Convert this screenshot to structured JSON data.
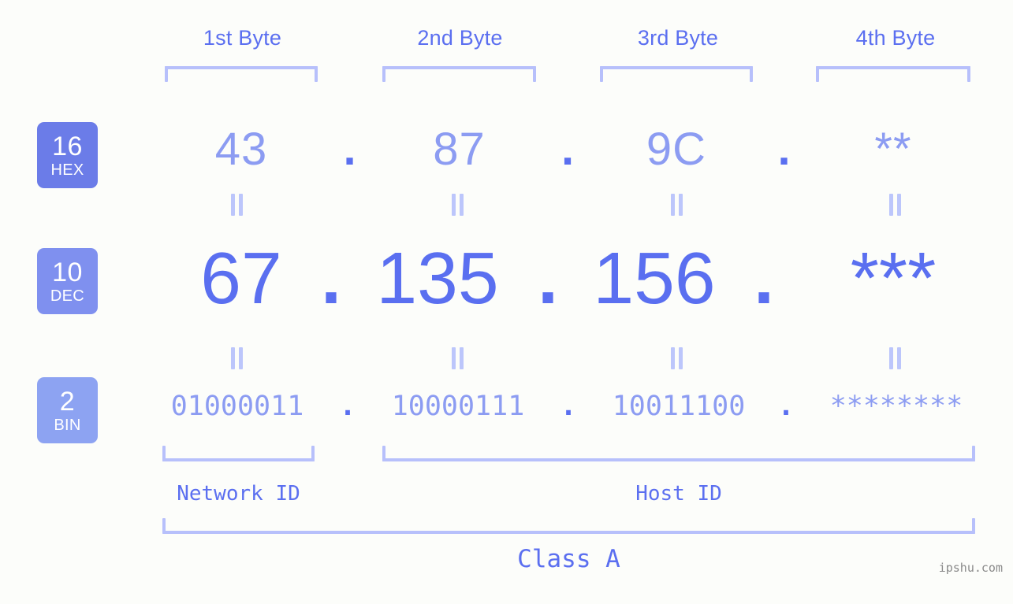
{
  "watermark": "ipshu.com",
  "columns": [
    {
      "header": "1st Byte"
    },
    {
      "header": "2nd Byte"
    },
    {
      "header": "3rd Byte"
    },
    {
      "header": "4th Byte"
    }
  ],
  "rows": {
    "hex": {
      "badge_num": "16",
      "badge_abbr": "HEX",
      "values": [
        "43",
        "87",
        "9C",
        "**"
      ],
      "separator": "."
    },
    "dec": {
      "badge_num": "10",
      "badge_abbr": "DEC",
      "values": [
        "67",
        "135",
        "156",
        "***"
      ],
      "separator": "."
    },
    "bin": {
      "badge_num": "2",
      "badge_abbr": "BIN",
      "values": [
        "01000011",
        "10000111",
        "10011100",
        "********"
      ],
      "separator": "."
    }
  },
  "sections": {
    "network_id": "Network ID",
    "host_id": "Host ID",
    "class": "Class A"
  },
  "colors": {
    "background": "#fcfdfa",
    "accent_strong": "#5a6ff0",
    "accent_mid": "#8c9cf2",
    "accent_light": "#b7c0fb",
    "badge_hex": "#6b7ce8",
    "badge_dec": "#7f90ef",
    "badge_bin": "#8da3f2",
    "watermark": "#8a8a8a"
  }
}
